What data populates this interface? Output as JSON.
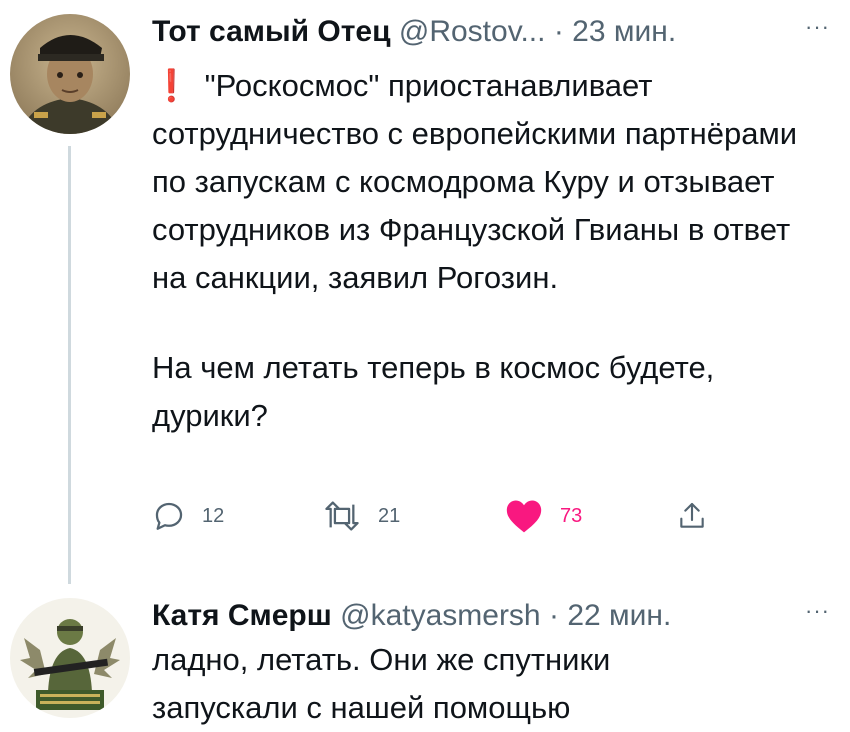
{
  "tweets": [
    {
      "display_name": "Тот самый Отец",
      "handle": "@Rostov...",
      "separator": "·",
      "time": "23 мин.",
      "more": "···",
      "alert": "❗",
      "paragraph1": "\"Роскосмос\" приостанавливает сотрудничество с европейскими партнёрами по запускам с космодрома Куру и отзывает сотрудников из Французской Гвианы в ответ на санкции, заявил Рогозин.",
      "paragraph2": "На чем летать теперь в космос будете, дурики?",
      "replies": "12",
      "retweets": "21",
      "likes": "73",
      "liked": true
    },
    {
      "display_name": "Катя Смерш",
      "handle": "@katyasmersh",
      "separator": "·",
      "time": "22 мин.",
      "more": "···",
      "text": "ладно, летать. Они же спутники запускали с нашей помощью"
    }
  ],
  "colors": {
    "text": "#0f1419",
    "secondary": "#536471",
    "like": "#f91880",
    "thread_line": "#cfd9de"
  },
  "icons": [
    "reply-icon",
    "retweet-icon",
    "heart-icon",
    "share-icon",
    "more-icon",
    "alert-icon"
  ]
}
